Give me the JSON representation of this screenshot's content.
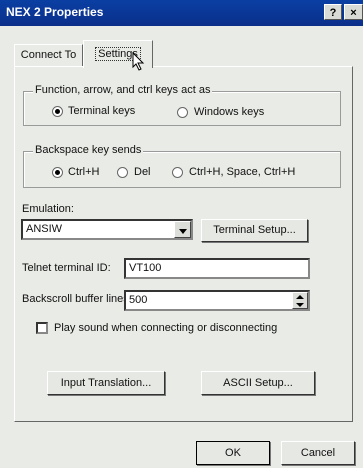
{
  "window": {
    "title": "NEX 2 Properties",
    "help_glyph": "?",
    "close_glyph": "×"
  },
  "tabs": [
    {
      "label": "Connect To"
    },
    {
      "label": "Settings"
    }
  ],
  "function_keys": {
    "legend": "Function, arrow, and ctrl keys act as",
    "options": [
      {
        "label": "Terminal keys",
        "selected": true
      },
      {
        "label": "Windows keys",
        "selected": false
      }
    ]
  },
  "backspace": {
    "legend": "Backspace key sends",
    "options": [
      {
        "label": "Ctrl+H",
        "selected": true
      },
      {
        "label": "Del",
        "selected": false
      },
      {
        "label": "Ctrl+H, Space, Ctrl+H",
        "selected": false
      }
    ]
  },
  "emulation": {
    "label": "Emulation:",
    "value": "ANSIW",
    "terminal_setup_label": "Terminal Setup..."
  },
  "telnet": {
    "label": "Telnet terminal ID:",
    "value": "VT100"
  },
  "backscroll": {
    "label": "Backscroll buffer lines:",
    "value": "500"
  },
  "sound": {
    "label": "Play sound when connecting or disconnecting",
    "checked": false
  },
  "buttons": {
    "input_translation": "Input Translation...",
    "ascii_setup": "ASCII Setup...",
    "ok": "OK",
    "cancel": "Cancel"
  }
}
